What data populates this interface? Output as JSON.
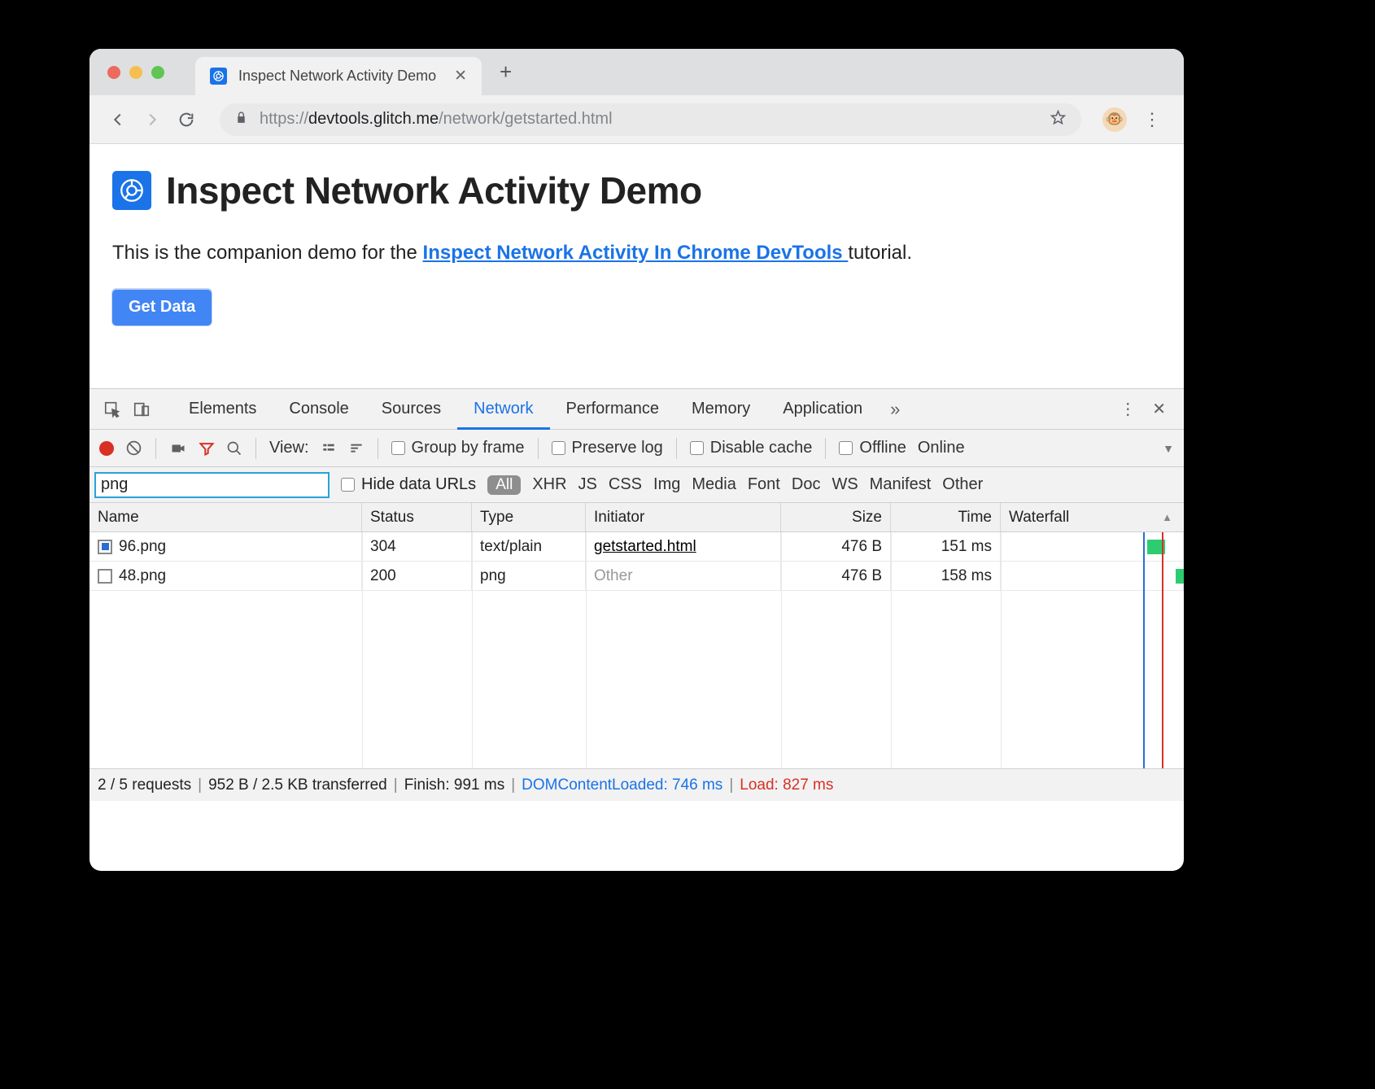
{
  "browser": {
    "tab_title": "Inspect Network Activity Demo",
    "url_scheme": "https://",
    "url_host": "devtools.glitch.me",
    "url_path": "/network/getstarted.html",
    "avatar_emoji": "🐵"
  },
  "page": {
    "heading": "Inspect Network Activity Demo",
    "body_pre": "This is the companion demo for the ",
    "body_link": "Inspect Network Activity In Chrome DevTools ",
    "body_post": "tutorial.",
    "button": "Get Data"
  },
  "devtools": {
    "tabs": [
      "Elements",
      "Console",
      "Sources",
      "Network",
      "Performance",
      "Memory",
      "Application"
    ],
    "active_tab": "Network",
    "toolbar": {
      "view_label": "View:",
      "group_by_frame": "Group by frame",
      "preserve_log": "Preserve log",
      "disable_cache": "Disable cache",
      "offline": "Offline",
      "online": "Online"
    },
    "filter": {
      "value": "png",
      "hide_data_urls": "Hide data URLs",
      "all": "All",
      "types": [
        "XHR",
        "JS",
        "CSS",
        "Img",
        "Media",
        "Font",
        "Doc",
        "WS",
        "Manifest",
        "Other"
      ]
    },
    "columns": {
      "name": "Name",
      "status": "Status",
      "type": "Type",
      "initiator": "Initiator",
      "size": "Size",
      "time": "Time",
      "waterfall": "Waterfall"
    },
    "rows": [
      {
        "name": "96.png",
        "status": "304",
        "type": "text/plain",
        "initiator": "getstarted.html",
        "initiator_kind": "link",
        "size": "476 B",
        "time": "151 ms",
        "thumb": "blue"
      },
      {
        "name": "48.png",
        "status": "200",
        "type": "png",
        "initiator": "Other",
        "initiator_kind": "other",
        "size": "476 B",
        "time": "158 ms",
        "thumb": "empty"
      }
    ],
    "status_bar": {
      "requests": "2 / 5 requests",
      "transferred": "952 B / 2.5 KB transferred",
      "finish": "Finish: 991 ms",
      "dcl": "DOMContentLoaded: 746 ms",
      "load": "Load: 827 ms"
    }
  }
}
